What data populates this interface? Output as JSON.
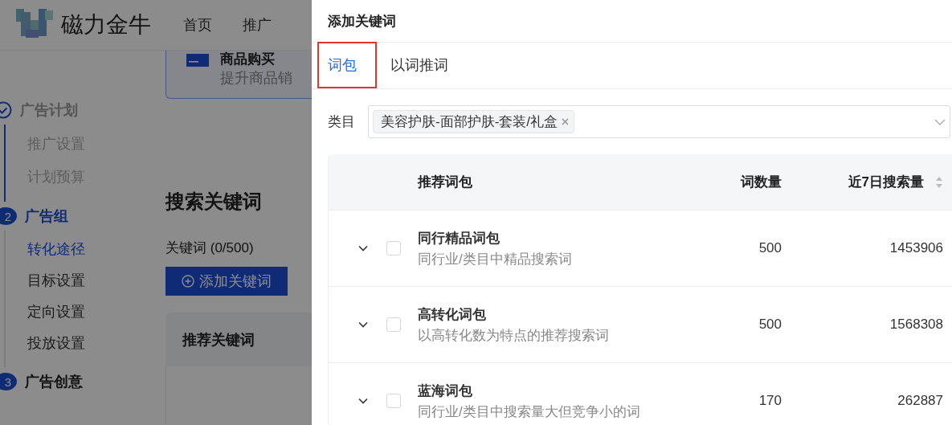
{
  "header": {
    "brand": "磁力金牛",
    "nav": [
      {
        "label": "首页"
      },
      {
        "label": "推广"
      }
    ]
  },
  "goal_card": {
    "title": "商品购买",
    "subtitle": "提升商品销"
  },
  "steps": [
    {
      "title": "广告计划",
      "kind": "done",
      "children": [
        {
          "label": "推广设置",
          "selected": false
        },
        {
          "label": "计划预算",
          "selected": false
        }
      ]
    },
    {
      "number": "2",
      "title": "广告组",
      "kind": "current",
      "children": [
        {
          "label": "转化途径",
          "selected": true
        },
        {
          "label": "目标设置",
          "selected": false
        },
        {
          "label": "定向设置",
          "selected": false
        },
        {
          "label": "投放设置",
          "selected": false
        }
      ]
    },
    {
      "number": "3",
      "title": "广告创意",
      "kind": "pending"
    }
  ],
  "keywords": {
    "title": "搜索关键词",
    "count": "关键词 (0/500)",
    "add_button": "添加关键词",
    "table_header": "推荐关键词"
  },
  "drawer": {
    "title": "添加关键词",
    "tabs": [
      {
        "label": "词包",
        "selected": true,
        "highlighted": true
      },
      {
        "label": "以词推词",
        "selected": false,
        "highlighted": false
      }
    ],
    "category": {
      "label": "类目",
      "tags": [
        {
          "label": "美容护肤-面部护肤-套装/礼盒"
        }
      ]
    },
    "table": {
      "columns": [
        {
          "label": "推荐词包",
          "sortable": false
        },
        {
          "label": "词数量",
          "sortable": false
        },
        {
          "label": "近7日搜索量",
          "sortable": true
        }
      ],
      "rows": [
        {
          "name": "同行精品词包",
          "description": "同行业/类目中精品搜索词",
          "count": "500",
          "searches": "1453906",
          "checked": false,
          "expanded": false
        },
        {
          "name": "高转化词包",
          "description": "以高转化数为特点的推荐搜索词",
          "count": "500",
          "searches": "1568308",
          "checked": false,
          "expanded": false
        },
        {
          "name": "蓝海词包",
          "description": "同行业/类目中搜索量大但竞争小的词",
          "count": "170",
          "searches": "262887",
          "checked": false,
          "expanded": false
        }
      ]
    }
  }
}
